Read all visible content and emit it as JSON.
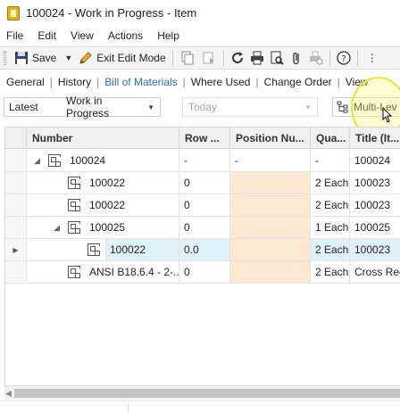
{
  "window": {
    "title": "100024 - Work in Progress - Item"
  },
  "menu": [
    "File",
    "Edit",
    "View",
    "Actions",
    "Help"
  ],
  "toolbar": {
    "save_label": "Save",
    "exit_edit_label": "Exit Edit Mode"
  },
  "tabs": [
    "General",
    "History",
    "Bill of Materials",
    "Where Used",
    "Change Order",
    "View"
  ],
  "active_tab": "Bill of Materials",
  "filters": {
    "revision": "Latest",
    "state": "Work in Progress",
    "date": "Today",
    "multilevel": "Multi-Lev"
  },
  "grid": {
    "columns": [
      "Number",
      "Row ...",
      "Position Nu...",
      "Qua...",
      "Title (It..."
    ],
    "rows": [
      {
        "number": "100024",
        "row": "-",
        "position": "-",
        "qty": "-",
        "title": "100024"
      },
      {
        "number": "100022",
        "row": "0",
        "position": "",
        "qty": "2 Each",
        "title": "100023"
      },
      {
        "number": "100022",
        "row": "0",
        "position": "",
        "qty": "2 Each",
        "title": "100023"
      },
      {
        "number": "100025",
        "row": "0",
        "position": "",
        "qty": "1 Each",
        "title": "100025"
      },
      {
        "number": "100022",
        "row": "0.0",
        "position": "",
        "qty": "2 Each",
        "title": "100023"
      },
      {
        "number": "ANSI B18.6.4 - 2-...",
        "row": "0",
        "position": "",
        "qty": "2 Each",
        "title": "Cross Rece"
      }
    ]
  },
  "colors": {
    "accent": "#2a6ebb",
    "selected_row": "#dff0f9",
    "position_cell": "#fce8d3",
    "cursor_highlight": "#ece13a"
  }
}
